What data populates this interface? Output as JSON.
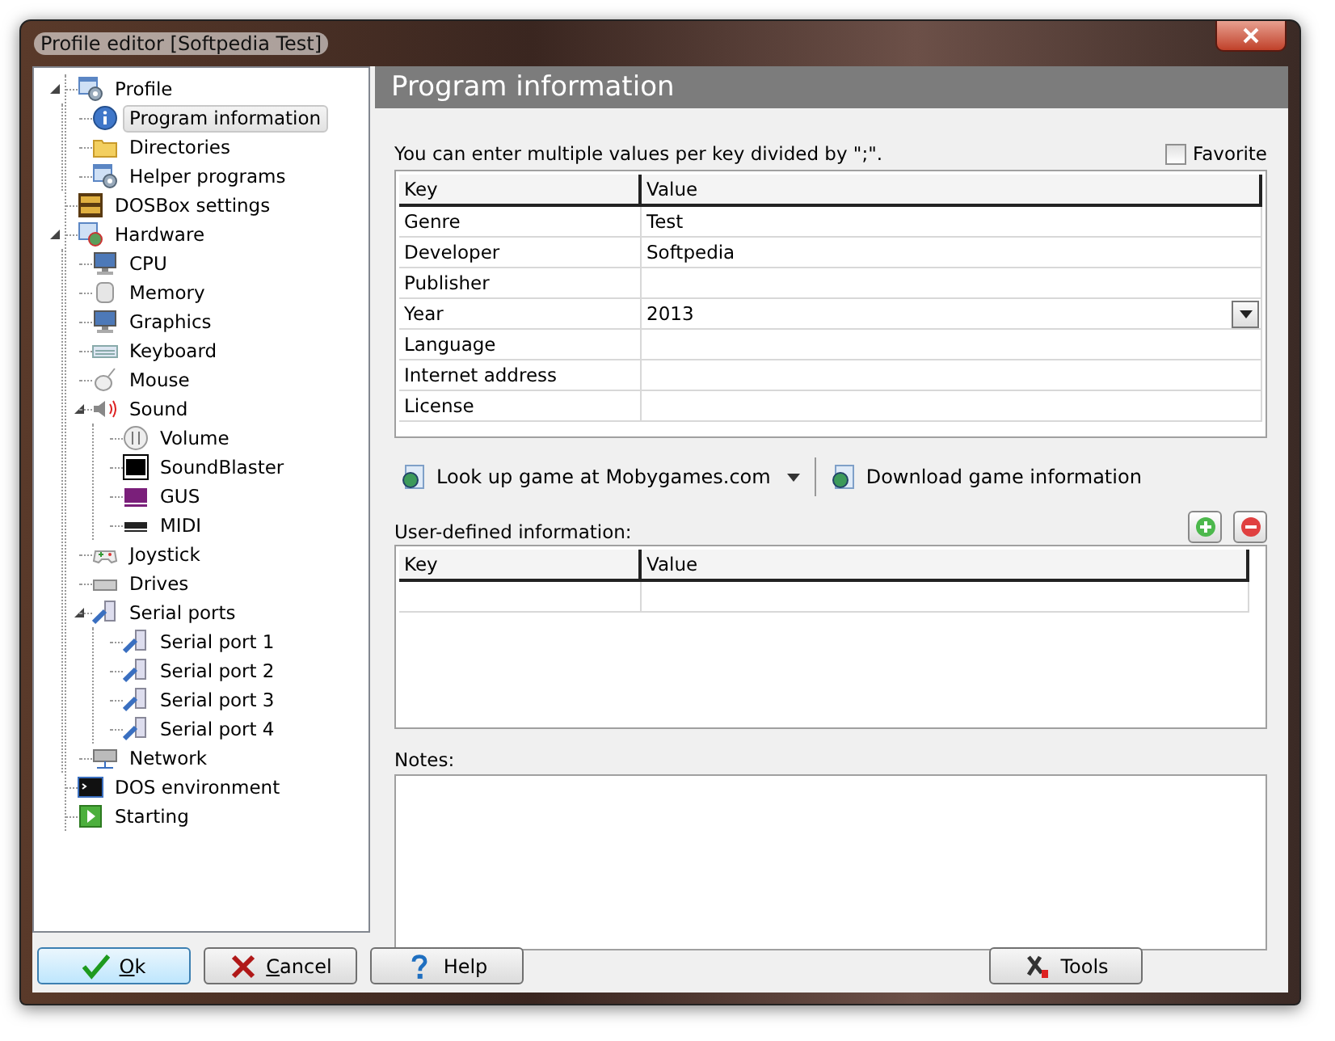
{
  "window": {
    "title": "Profile editor [Softpedia Test]"
  },
  "tree": [
    {
      "label": "Profile",
      "kind": "profile",
      "selected": false,
      "expanded": true,
      "children": [
        {
          "label": "Program information",
          "kind": "info",
          "selected": true
        },
        {
          "label": "Directories",
          "kind": "folder",
          "selected": false
        },
        {
          "label": "Helper programs",
          "kind": "profile",
          "selected": false
        }
      ]
    },
    {
      "label": "DOSBox settings",
      "kind": "dosbox",
      "selected": false
    },
    {
      "label": "Hardware",
      "kind": "hardware",
      "selected": false,
      "expanded": true,
      "children": [
        {
          "label": "CPU",
          "kind": "computer",
          "selected": false
        },
        {
          "label": "Memory",
          "kind": "memory",
          "selected": false
        },
        {
          "label": "Graphics",
          "kind": "monitor",
          "selected": false
        },
        {
          "label": "Keyboard",
          "kind": "keyboard",
          "selected": false
        },
        {
          "label": "Mouse",
          "kind": "mouse",
          "selected": false
        },
        {
          "label": "Sound",
          "kind": "speaker",
          "selected": false,
          "expanded": true,
          "children": [
            {
              "label": "Volume",
              "kind": "volume",
              "selected": false
            },
            {
              "label": "SoundBlaster",
              "kind": "sb",
              "selected": false
            },
            {
              "label": "GUS",
              "kind": "gus",
              "selected": false
            },
            {
              "label": "MIDI",
              "kind": "midi",
              "selected": false
            }
          ]
        },
        {
          "label": "Joystick",
          "kind": "gamepad",
          "selected": false
        },
        {
          "label": "Drives",
          "kind": "drive",
          "selected": false
        },
        {
          "label": "Serial ports",
          "kind": "plug",
          "selected": false,
          "expanded": true,
          "children": [
            {
              "label": "Serial port 1",
              "kind": "plug",
              "selected": false
            },
            {
              "label": "Serial port 2",
              "kind": "plug",
              "selected": false
            },
            {
              "label": "Serial port 3",
              "kind": "plug",
              "selected": false
            },
            {
              "label": "Serial port 4",
              "kind": "plug",
              "selected": false
            }
          ]
        },
        {
          "label": "Network",
          "kind": "network",
          "selected": false
        }
      ]
    },
    {
      "label": "DOS environment",
      "kind": "console",
      "selected": false
    },
    {
      "label": "Starting",
      "kind": "start",
      "selected": false
    }
  ],
  "panel": {
    "title": "Program information",
    "hint": "You can enter multiple values per key divided by \";\".",
    "favorite": {
      "label": "Favorite",
      "checked": false
    },
    "table": {
      "columns": [
        "Key",
        "Value"
      ],
      "rows": [
        {
          "key": "Genre",
          "value": "Test"
        },
        {
          "key": "Developer",
          "value": "Softpedia"
        },
        {
          "key": "Publisher"
        },
        {
          "key": "Year",
          "value": "2013",
          "kind": "dropdown"
        },
        {
          "key": "Language"
        },
        {
          "key": "Internet address"
        },
        {
          "key": "License"
        }
      ]
    },
    "actions": [
      {
        "label": "Look up game at Mobygames.com",
        "menu": true
      },
      {
        "label": "Download game information",
        "menu": false
      }
    ],
    "user_defined": {
      "label": "User-defined information:",
      "columns": [
        "Key",
        "Value"
      ]
    },
    "notes": {
      "label": "Notes:"
    }
  },
  "buttons": [
    {
      "label": "Ok",
      "kind": "ok",
      "default": true,
      "mnemonic": true
    },
    {
      "label": "Cancel",
      "kind": "cancel",
      "default": false,
      "mnemonic": true
    },
    {
      "label": "Help",
      "kind": "help",
      "default": false,
      "mnemonic": false
    },
    {
      "label": "Tools",
      "kind": "tools",
      "default": false,
      "mnemonic": false
    }
  ]
}
